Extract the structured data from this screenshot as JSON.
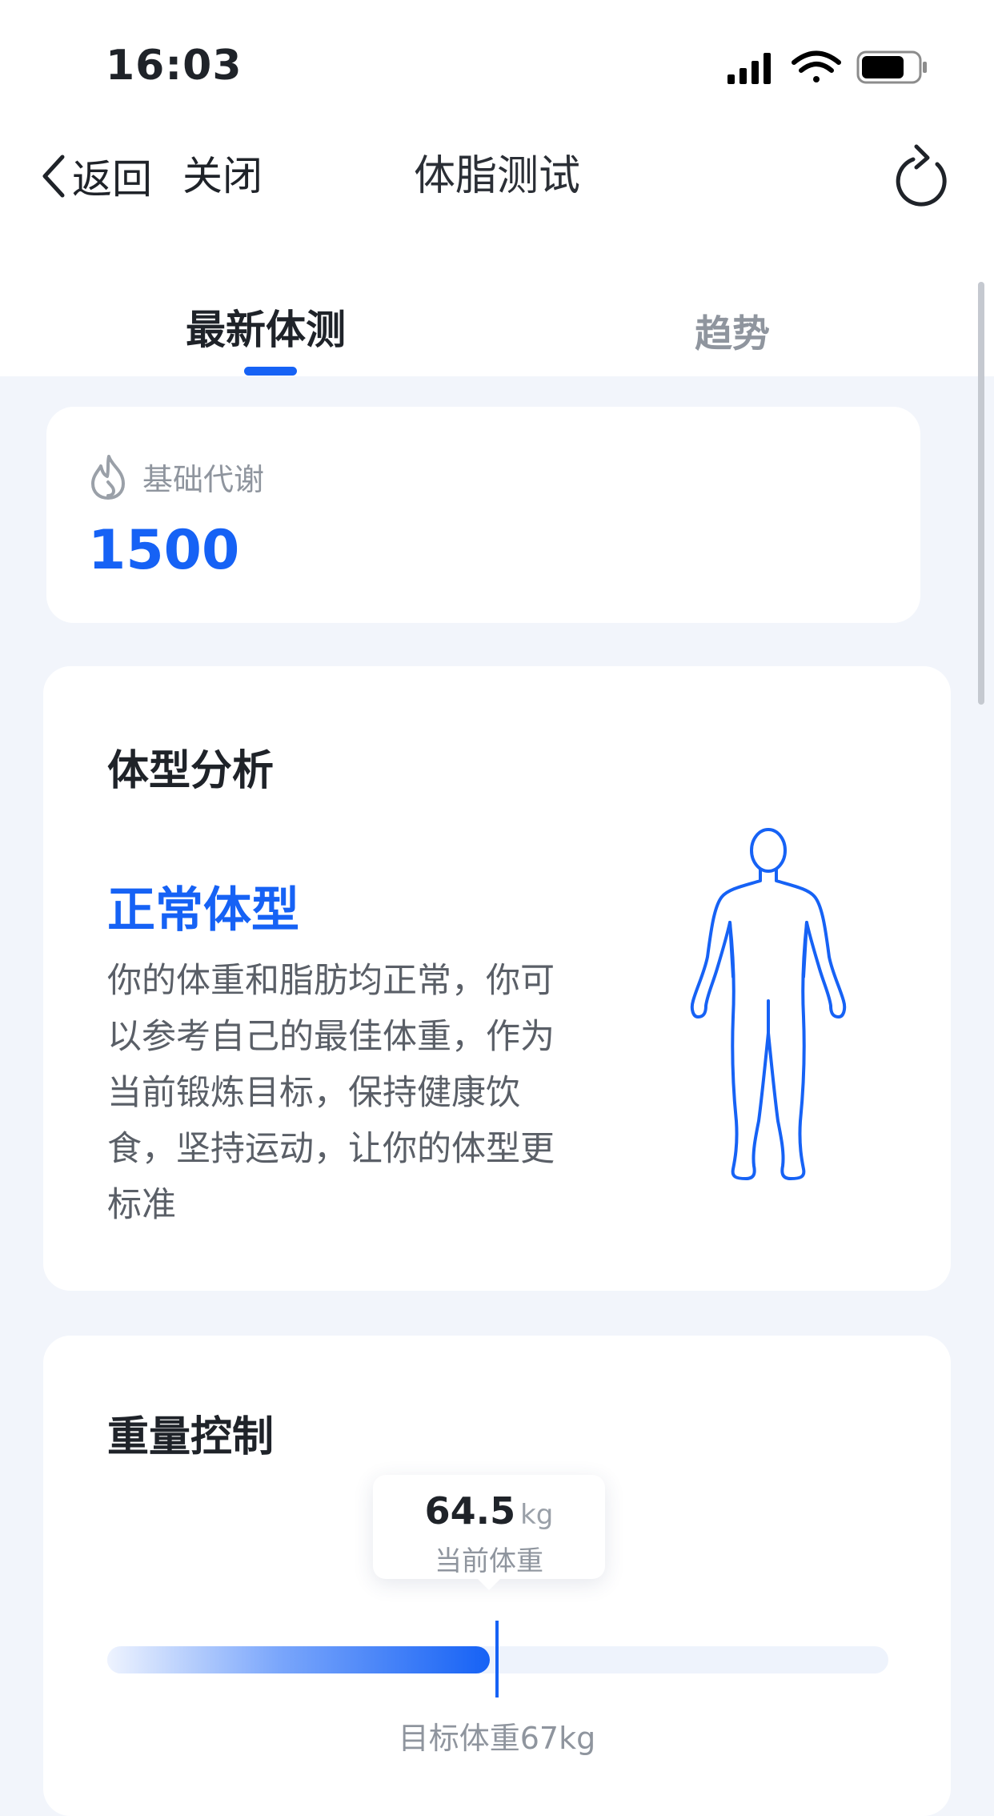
{
  "status_bar": {
    "time": "16:03"
  },
  "nav": {
    "back_label": "返回",
    "close_label": "关闭",
    "title": "体脂测试"
  },
  "tabs": [
    {
      "label": "最新体测",
      "active": true
    },
    {
      "label": "趋势",
      "active": false
    }
  ],
  "bmr": {
    "label": "基础代谢",
    "value": "1500",
    "icon": "flame-icon"
  },
  "body_analysis": {
    "title": "体型分析",
    "type": "正常体型",
    "description": "你的体重和脂肪均正常，你可以参考自己的最佳体重，作为当前锻炼目标，保持健康饮食，坚持运动，让你的体型更标准",
    "figure_icon": "human-body-outline-icon"
  },
  "weight_control": {
    "title": "重量控制",
    "current_value": "64.5",
    "unit": "kg",
    "current_label": "当前体重",
    "target_label": "目标体重67kg",
    "progress_fraction": 0.49
  },
  "colors": {
    "accent": "#1662f5",
    "background": "#f2f5fb",
    "text_primary": "#1f2329",
    "text_secondary": "#8f959e"
  }
}
